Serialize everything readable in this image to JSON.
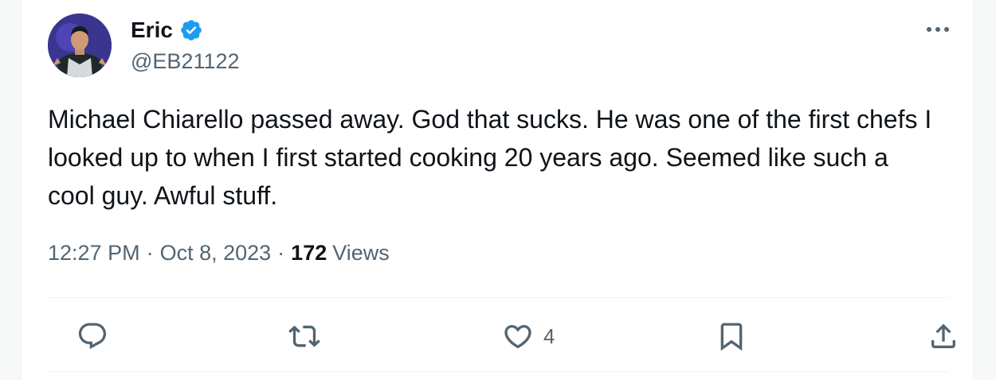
{
  "user": {
    "name": "Eric",
    "handle": "@EB21122",
    "verified_icon": "verified-badge-icon"
  },
  "tweet": {
    "text": "Michael Chiarello passed away. God that sucks. He was one of the first chefs I looked up to when I first started cooking 20 years ago. Seemed like such a cool guy. Awful stuff.",
    "time": "12:27 PM",
    "date": "Oct 8, 2023",
    "separator": "·",
    "views_count": "172",
    "views_label": "Views"
  },
  "actions": {
    "reply_icon": "reply-icon",
    "retweet_icon": "retweet-icon",
    "like_icon": "heart-icon",
    "like_count": "4",
    "bookmark_icon": "bookmark-icon",
    "share_icon": "share-icon"
  },
  "colors": {
    "accent": "#1d9bf0",
    "text_primary": "#0f1419",
    "text_secondary": "#536471",
    "divider": "#eff3f4"
  }
}
